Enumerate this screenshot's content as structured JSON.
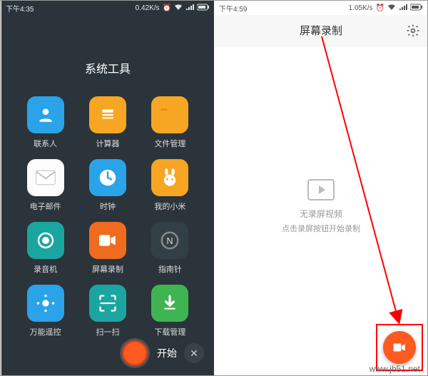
{
  "left": {
    "status": {
      "time": "下午4:35",
      "net": "0.42K/s"
    },
    "folder_title": "系统工具",
    "apps": [
      {
        "label": "联系人"
      },
      {
        "label": "计算器"
      },
      {
        "label": "文件管理"
      },
      {
        "label": "电子邮件"
      },
      {
        "label": "时钟"
      },
      {
        "label": "我的小米"
      },
      {
        "label": "录音机"
      },
      {
        "label": "屏幕录制"
      },
      {
        "label": "指南针"
      },
      {
        "label": "万能遥控"
      },
      {
        "label": "扫一扫"
      },
      {
        "label": "下载管理"
      }
    ],
    "start_label": "开始",
    "close_glyph": "✕"
  },
  "right": {
    "status": {
      "time": "下午4:59",
      "net": "1.05K/s"
    },
    "header_title": "屏幕录制",
    "empty_line1": "无录屏视频",
    "empty_line2": "点击录屏按钮开始录制"
  },
  "watermark": "www.jb51.net",
  "colors": {
    "accent": "#ff5a1f",
    "highlight": "#f00"
  }
}
